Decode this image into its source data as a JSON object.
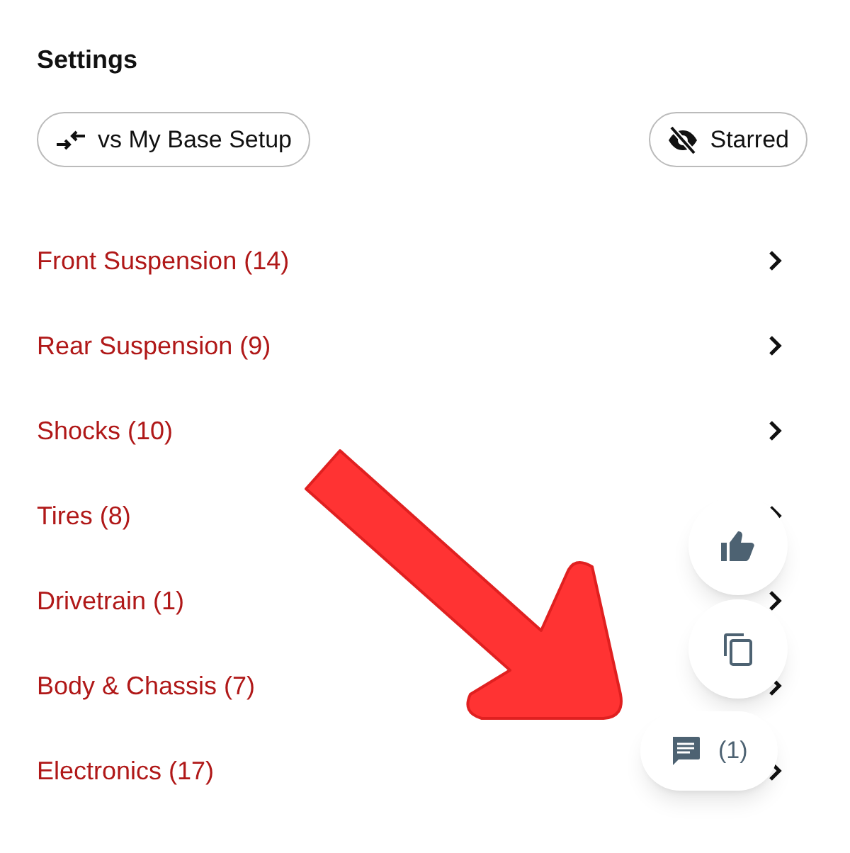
{
  "title": "Settings",
  "compare_button": {
    "label": "vs My Base Setup"
  },
  "starred_button": {
    "label": "Starred"
  },
  "categories": [
    {
      "label": "Front Suspension (14)"
    },
    {
      "label": "Rear Suspension (9)"
    },
    {
      "label": "Shocks (10)"
    },
    {
      "label": "Tires (8)"
    },
    {
      "label": "Drivetrain (1)"
    },
    {
      "label": "Body & Chassis (7)"
    },
    {
      "label": "Electronics (17)"
    }
  ],
  "floating_buttons": [
    {
      "kind": "like"
    },
    {
      "kind": "copy"
    },
    {
      "kind": "comments",
      "label": "(1)"
    }
  ],
  "annotation": {
    "kind": "arrow"
  }
}
